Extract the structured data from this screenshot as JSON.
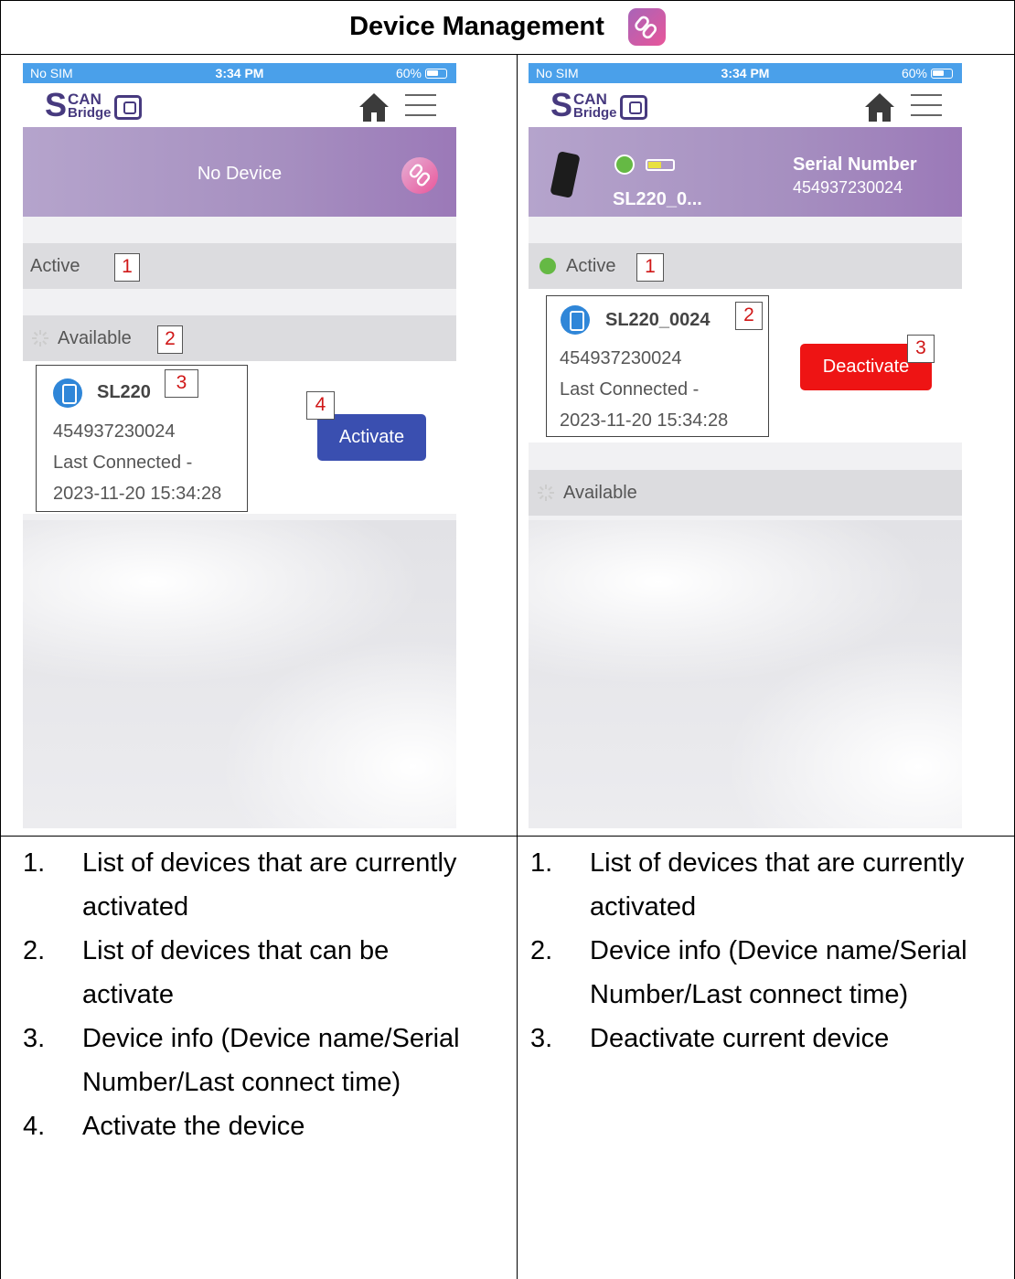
{
  "title": "Device Management",
  "icons": {
    "title": "link-icon",
    "home": "home-icon",
    "menu": "hamburger-menu-icon"
  },
  "colors": {
    "status_bar": "#4aa0ea",
    "brand": "#473a7f",
    "activate": "#3a4fb0",
    "deactivate": "#ee1414",
    "annotation": "#d01818",
    "active_dot": "#65b944"
  },
  "status_bar": {
    "carrier": "No SIM",
    "time": "3:34 PM",
    "battery": "60%"
  },
  "logo": {
    "s": "S",
    "can": "CAN",
    "bridge": "Bridge"
  },
  "left_phone": {
    "header_text": "No Device",
    "active_label": "Active",
    "available_label": "Available",
    "device": {
      "name": "SL220",
      "serial": "454937230024",
      "last_connected": "Last Connected -",
      "datetime": "2023-11-20 15:34:28"
    },
    "button": "Activate",
    "markers": [
      "1",
      "2",
      "3",
      "4"
    ]
  },
  "right_phone": {
    "header_device": "SL220_0...",
    "serial_label": "Serial Number",
    "serial_value": "454937230024",
    "active_label": "Active",
    "available_label": "Available",
    "device": {
      "name": "SL220_0024",
      "serial": "454937230024",
      "last_connected": "Last Connected -",
      "datetime": "2023-11-20 15:34:28"
    },
    "button": "Deactivate",
    "markers": [
      "1",
      "2",
      "3"
    ]
  },
  "left_notes": [
    {
      "num": "1.",
      "line1": "List of devices that are currently",
      "line2": "activated"
    },
    {
      "num": "2.",
      "line1": "List of devices that can be",
      "line2": "activate"
    },
    {
      "num": "3.",
      "line1": "Device info (Device name/Serial",
      "line2": "Number/Last connect time)"
    },
    {
      "num": "4.",
      "line1": "Activate the device"
    }
  ],
  "right_notes": [
    {
      "num": "1.",
      "line1": "List of devices that are currently",
      "line2": "activated"
    },
    {
      "num": "2.",
      "line1": "Device info (Device name/Serial",
      "line2": "Number/Last connect time)"
    },
    {
      "num": "3.",
      "line1": "Deactivate current device"
    }
  ]
}
